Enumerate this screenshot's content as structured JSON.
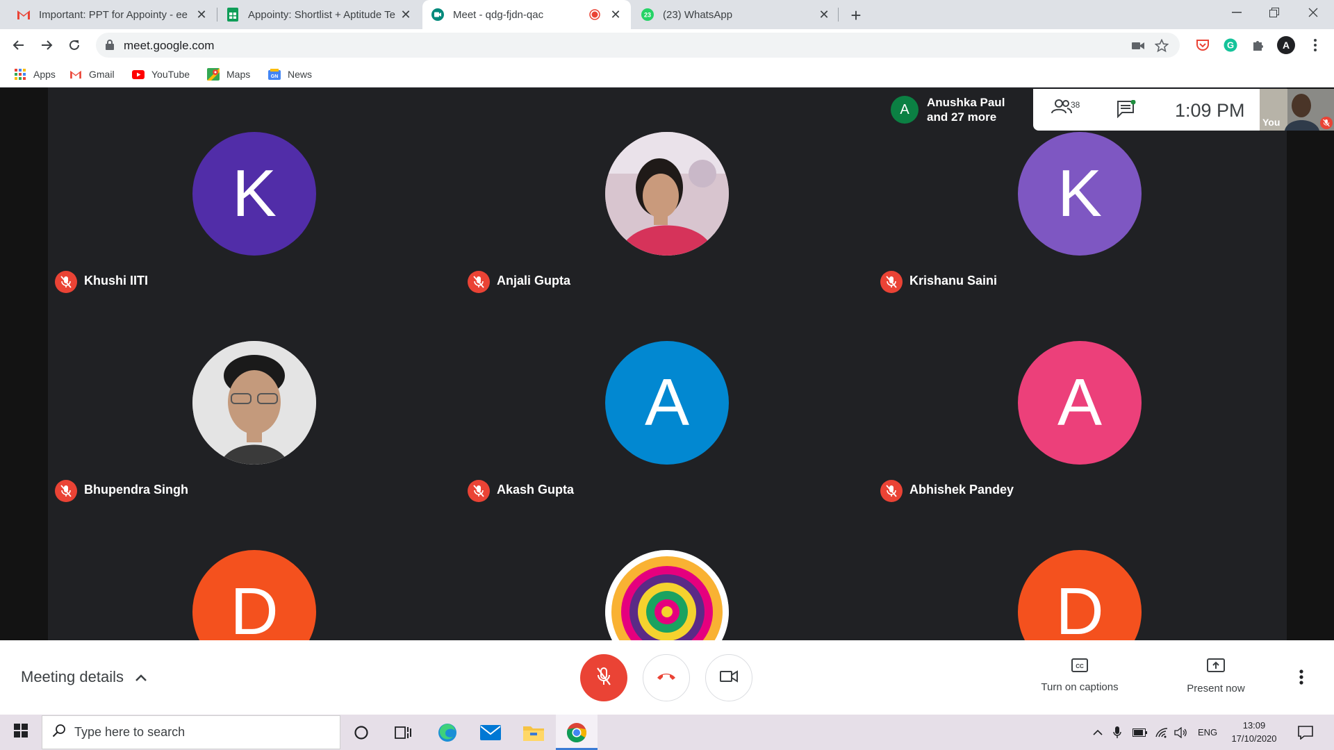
{
  "browser": {
    "tabs": [
      {
        "title": "Important: PPT for Appointy - ee",
        "icon": "gmail-icon"
      },
      {
        "title": "Appointy: Shortlist + Aptitude Te",
        "icon": "sheets-icon"
      },
      {
        "title": "Meet - qdg-fjdn-qac",
        "icon": "meet-icon",
        "active": true,
        "recording": true
      },
      {
        "title": "(23) WhatsApp",
        "icon": "whatsapp-icon",
        "badge": "23"
      }
    ],
    "url": "meet.google.com",
    "bookmarks": [
      {
        "label": "Apps",
        "icon": "apps-grid-icon"
      },
      {
        "label": "Gmail",
        "icon": "gmail-icon"
      },
      {
        "label": "YouTube",
        "icon": "youtube-icon"
      },
      {
        "label": "Maps",
        "icon": "maps-icon"
      },
      {
        "label": "News",
        "icon": "news-icon"
      }
    ],
    "profile_initial": "A"
  },
  "meet": {
    "active_speaker": {
      "initial": "A",
      "line1": "Anushka Paul",
      "line2": "and 27 more",
      "color": "#0b8043"
    },
    "participant_count": "38",
    "clock": "1:09  PM",
    "self_label": "You",
    "participants": [
      {
        "name": "Khushi IITI",
        "initial": "K",
        "color": "#512da8",
        "photo": false
      },
      {
        "name": "Anjali Gupta",
        "initial": "",
        "color": "#c2185b",
        "photo": true
      },
      {
        "name": "Krishanu Saini",
        "initial": "K",
        "color": "#7e57c2",
        "photo": false
      },
      {
        "name": "Bhupendra Singh",
        "initial": "",
        "color": "#9e9e9e",
        "photo": true
      },
      {
        "name": "Akash Gupta",
        "initial": "A",
        "color": "#0288d1",
        "photo": false
      },
      {
        "name": "Abhishek Pandey",
        "initial": "A",
        "color": "#ec407a",
        "photo": false
      },
      {
        "name": "",
        "initial": "D",
        "color": "#f4511e",
        "photo": false
      },
      {
        "name": "",
        "initial": "",
        "color": "#ffffff",
        "photo": true
      },
      {
        "name": "",
        "initial": "D",
        "color": "#f4511e",
        "photo": false
      }
    ],
    "bottom": {
      "meeting_details": "Meeting details",
      "captions": "Turn on captions",
      "present": "Present now"
    }
  },
  "taskbar": {
    "search_placeholder": "Type here to search",
    "language": "ENG",
    "time": "13:09",
    "date": "17/10/2020"
  },
  "colors": {
    "mute_red": "#ea4335",
    "meet_bg": "#202124"
  }
}
